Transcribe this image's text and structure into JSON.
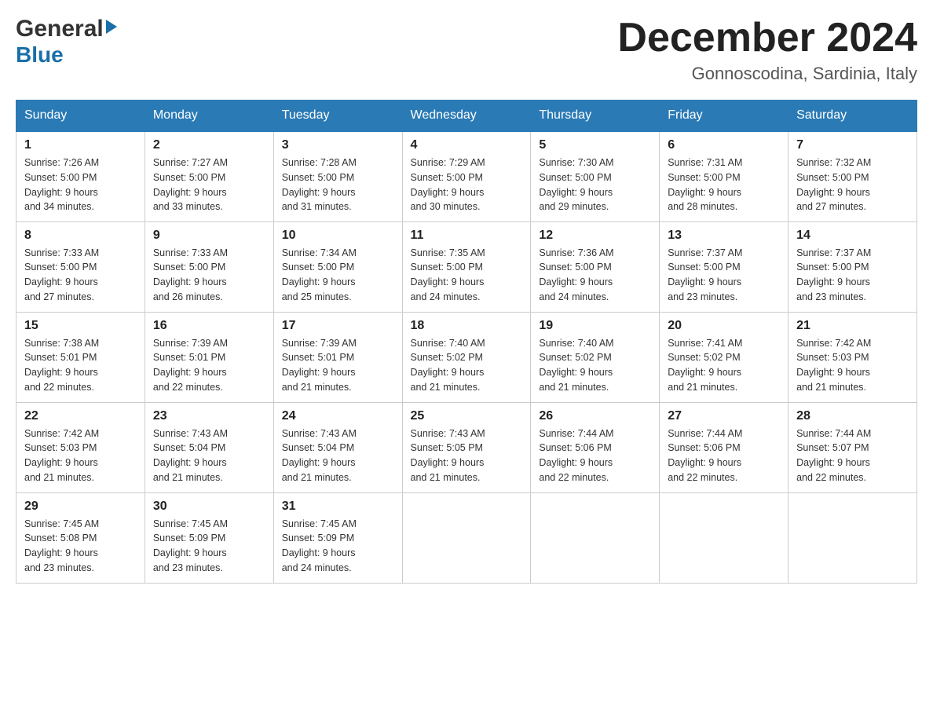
{
  "logo": {
    "general": "General",
    "blue": "Blue",
    "alt": "GeneralBlue logo"
  },
  "header": {
    "month": "December 2024",
    "location": "Gonnoscodina, Sardinia, Italy"
  },
  "weekdays": [
    "Sunday",
    "Monday",
    "Tuesday",
    "Wednesday",
    "Thursday",
    "Friday",
    "Saturday"
  ],
  "weeks": [
    [
      {
        "day": "1",
        "sunrise": "Sunrise: 7:26 AM",
        "sunset": "Sunset: 5:00 PM",
        "daylight": "Daylight: 9 hours",
        "minutes": "and 34 minutes."
      },
      {
        "day": "2",
        "sunrise": "Sunrise: 7:27 AM",
        "sunset": "Sunset: 5:00 PM",
        "daylight": "Daylight: 9 hours",
        "minutes": "and 33 minutes."
      },
      {
        "day": "3",
        "sunrise": "Sunrise: 7:28 AM",
        "sunset": "Sunset: 5:00 PM",
        "daylight": "Daylight: 9 hours",
        "minutes": "and 31 minutes."
      },
      {
        "day": "4",
        "sunrise": "Sunrise: 7:29 AM",
        "sunset": "Sunset: 5:00 PM",
        "daylight": "Daylight: 9 hours",
        "minutes": "and 30 minutes."
      },
      {
        "day": "5",
        "sunrise": "Sunrise: 7:30 AM",
        "sunset": "Sunset: 5:00 PM",
        "daylight": "Daylight: 9 hours",
        "minutes": "and 29 minutes."
      },
      {
        "day": "6",
        "sunrise": "Sunrise: 7:31 AM",
        "sunset": "Sunset: 5:00 PM",
        "daylight": "Daylight: 9 hours",
        "minutes": "and 28 minutes."
      },
      {
        "day": "7",
        "sunrise": "Sunrise: 7:32 AM",
        "sunset": "Sunset: 5:00 PM",
        "daylight": "Daylight: 9 hours",
        "minutes": "and 27 minutes."
      }
    ],
    [
      {
        "day": "8",
        "sunrise": "Sunrise: 7:33 AM",
        "sunset": "Sunset: 5:00 PM",
        "daylight": "Daylight: 9 hours",
        "minutes": "and 27 minutes."
      },
      {
        "day": "9",
        "sunrise": "Sunrise: 7:33 AM",
        "sunset": "Sunset: 5:00 PM",
        "daylight": "Daylight: 9 hours",
        "minutes": "and 26 minutes."
      },
      {
        "day": "10",
        "sunrise": "Sunrise: 7:34 AM",
        "sunset": "Sunset: 5:00 PM",
        "daylight": "Daylight: 9 hours",
        "minutes": "and 25 minutes."
      },
      {
        "day": "11",
        "sunrise": "Sunrise: 7:35 AM",
        "sunset": "Sunset: 5:00 PM",
        "daylight": "Daylight: 9 hours",
        "minutes": "and 24 minutes."
      },
      {
        "day": "12",
        "sunrise": "Sunrise: 7:36 AM",
        "sunset": "Sunset: 5:00 PM",
        "daylight": "Daylight: 9 hours",
        "minutes": "and 24 minutes."
      },
      {
        "day": "13",
        "sunrise": "Sunrise: 7:37 AM",
        "sunset": "Sunset: 5:00 PM",
        "daylight": "Daylight: 9 hours",
        "minutes": "and 23 minutes."
      },
      {
        "day": "14",
        "sunrise": "Sunrise: 7:37 AM",
        "sunset": "Sunset: 5:00 PM",
        "daylight": "Daylight: 9 hours",
        "minutes": "and 23 minutes."
      }
    ],
    [
      {
        "day": "15",
        "sunrise": "Sunrise: 7:38 AM",
        "sunset": "Sunset: 5:01 PM",
        "daylight": "Daylight: 9 hours",
        "minutes": "and 22 minutes."
      },
      {
        "day": "16",
        "sunrise": "Sunrise: 7:39 AM",
        "sunset": "Sunset: 5:01 PM",
        "daylight": "Daylight: 9 hours",
        "minutes": "and 22 minutes."
      },
      {
        "day": "17",
        "sunrise": "Sunrise: 7:39 AM",
        "sunset": "Sunset: 5:01 PM",
        "daylight": "Daylight: 9 hours",
        "minutes": "and 21 minutes."
      },
      {
        "day": "18",
        "sunrise": "Sunrise: 7:40 AM",
        "sunset": "Sunset: 5:02 PM",
        "daylight": "Daylight: 9 hours",
        "minutes": "and 21 minutes."
      },
      {
        "day": "19",
        "sunrise": "Sunrise: 7:40 AM",
        "sunset": "Sunset: 5:02 PM",
        "daylight": "Daylight: 9 hours",
        "minutes": "and 21 minutes."
      },
      {
        "day": "20",
        "sunrise": "Sunrise: 7:41 AM",
        "sunset": "Sunset: 5:02 PM",
        "daylight": "Daylight: 9 hours",
        "minutes": "and 21 minutes."
      },
      {
        "day": "21",
        "sunrise": "Sunrise: 7:42 AM",
        "sunset": "Sunset: 5:03 PM",
        "daylight": "Daylight: 9 hours",
        "minutes": "and 21 minutes."
      }
    ],
    [
      {
        "day": "22",
        "sunrise": "Sunrise: 7:42 AM",
        "sunset": "Sunset: 5:03 PM",
        "daylight": "Daylight: 9 hours",
        "minutes": "and 21 minutes."
      },
      {
        "day": "23",
        "sunrise": "Sunrise: 7:43 AM",
        "sunset": "Sunset: 5:04 PM",
        "daylight": "Daylight: 9 hours",
        "minutes": "and 21 minutes."
      },
      {
        "day": "24",
        "sunrise": "Sunrise: 7:43 AM",
        "sunset": "Sunset: 5:04 PM",
        "daylight": "Daylight: 9 hours",
        "minutes": "and 21 minutes."
      },
      {
        "day": "25",
        "sunrise": "Sunrise: 7:43 AM",
        "sunset": "Sunset: 5:05 PM",
        "daylight": "Daylight: 9 hours",
        "minutes": "and 21 minutes."
      },
      {
        "day": "26",
        "sunrise": "Sunrise: 7:44 AM",
        "sunset": "Sunset: 5:06 PM",
        "daylight": "Daylight: 9 hours",
        "minutes": "and 22 minutes."
      },
      {
        "day": "27",
        "sunrise": "Sunrise: 7:44 AM",
        "sunset": "Sunset: 5:06 PM",
        "daylight": "Daylight: 9 hours",
        "minutes": "and 22 minutes."
      },
      {
        "day": "28",
        "sunrise": "Sunrise: 7:44 AM",
        "sunset": "Sunset: 5:07 PM",
        "daylight": "Daylight: 9 hours",
        "minutes": "and 22 minutes."
      }
    ],
    [
      {
        "day": "29",
        "sunrise": "Sunrise: 7:45 AM",
        "sunset": "Sunset: 5:08 PM",
        "daylight": "Daylight: 9 hours",
        "minutes": "and 23 minutes."
      },
      {
        "day": "30",
        "sunrise": "Sunrise: 7:45 AM",
        "sunset": "Sunset: 5:09 PM",
        "daylight": "Daylight: 9 hours",
        "minutes": "and 23 minutes."
      },
      {
        "day": "31",
        "sunrise": "Sunrise: 7:45 AM",
        "sunset": "Sunset: 5:09 PM",
        "daylight": "Daylight: 9 hours",
        "minutes": "and 24 minutes."
      },
      null,
      null,
      null,
      null
    ]
  ]
}
